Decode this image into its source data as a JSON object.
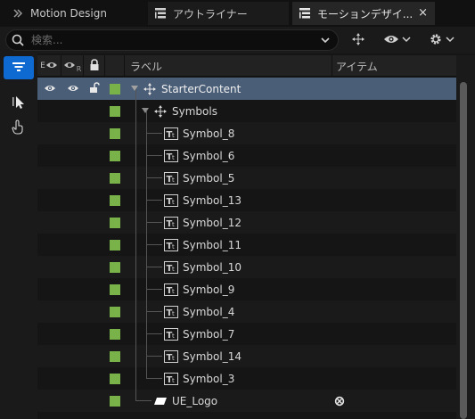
{
  "tabs": [
    {
      "label": "Motion Design",
      "icon": "double-chevron-icon"
    },
    {
      "label": "アウトライナー",
      "icon": "outliner-icon"
    },
    {
      "label": "モーションデザイ...",
      "icon": "outliner-icon",
      "close": "×"
    }
  ],
  "search": {
    "placeholder": "検索..."
  },
  "header": {
    "col_visibility_prefix": "E",
    "col_visibility_sub": "",
    "col_render_sub": "R",
    "col_label": "ラベル",
    "col_item": "アイテム"
  },
  "colors": {
    "accent": "#0e6ad0",
    "selection": "#4a5e78",
    "color_swatch": "#7ab24a"
  },
  "rows": [
    {
      "label": "StarterContent",
      "icon": "actor-gizmo-icon",
      "depth": 0,
      "expanded": true,
      "selected": true,
      "vis": true
    },
    {
      "label": "Symbols",
      "icon": "actor-gizmo-icon",
      "depth": 1,
      "expanded": true,
      "selected": false,
      "vis": false
    },
    {
      "label": "Symbol_8",
      "icon": "text-icon",
      "depth": 2
    },
    {
      "label": "Symbol_6",
      "icon": "text-icon",
      "depth": 2
    },
    {
      "label": "Symbol_5",
      "icon": "text-icon",
      "depth": 2
    },
    {
      "label": "Symbol_13",
      "icon": "text-icon",
      "depth": 2
    },
    {
      "label": "Symbol_12",
      "icon": "text-icon",
      "depth": 2
    },
    {
      "label": "Symbol_11",
      "icon": "text-icon",
      "depth": 2
    },
    {
      "label": "Symbol_10",
      "icon": "text-icon",
      "depth": 2
    },
    {
      "label": "Symbol_9",
      "icon": "text-icon",
      "depth": 2
    },
    {
      "label": "Symbol_4",
      "icon": "text-icon",
      "depth": 2
    },
    {
      "label": "Symbol_7",
      "icon": "text-icon",
      "depth": 2
    },
    {
      "label": "Symbol_14",
      "icon": "text-icon",
      "depth": 2
    },
    {
      "label": "Symbol_3",
      "icon": "text-icon",
      "depth": 2
    },
    {
      "label": "UE_Logo",
      "icon": "plane-icon",
      "depth": 1,
      "item_icon": "material-ball-icon"
    }
  ]
}
